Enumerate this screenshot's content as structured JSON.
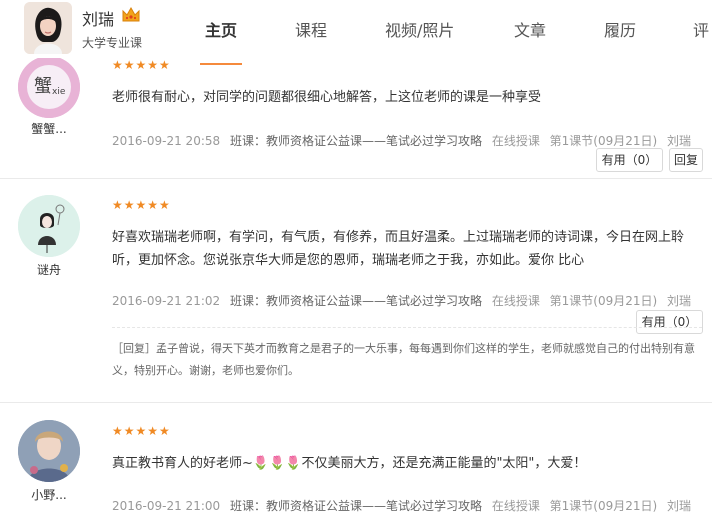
{
  "header": {
    "teacher_name": "刘瑞",
    "teacher_subtitle": "大学专业课",
    "nav": [
      {
        "label": "主页",
        "active": true
      },
      {
        "label": "课程",
        "active": false
      },
      {
        "label": "视频/照片",
        "active": false
      },
      {
        "label": "文章",
        "active": false
      },
      {
        "label": "履历",
        "active": false
      },
      {
        "label": "评",
        "active": false
      }
    ]
  },
  "reviews": [
    {
      "user": "蟹蟹...",
      "avatar_icon": "xie-doodle-avatar",
      "rating": 5,
      "stars": "★★★★★",
      "content": "老师很有耐心，对同学的问题都很细心地解答，上这位老师的课是一种享受",
      "date": "2016-09-21 20:58",
      "class": "班课：教师资格证公益课——笔试必过学习攻略",
      "mode": "在线授课",
      "lesson": "第1课节(09月21日)",
      "teacher": "刘瑞",
      "useful_label": "有用（0）",
      "reply_label": "回复"
    },
    {
      "user": "谜舟",
      "avatar_icon": "girl-doodle-avatar",
      "rating": 5,
      "stars": "★★★★★",
      "content": "好喜欢瑞瑞老师啊，有学问，有气质，有修养，而且好温柔。上过瑞瑞老师的诗词课，今日在网上聆听，更加怀念。您说张京华大师是您的恩师，瑞瑞老师之于我，亦如此。爱你  比心",
      "date": "2016-09-21 21:02",
      "class": "班课：教师资格证公益课——笔试必过学习攻略",
      "mode": "在线授课",
      "lesson": "第1课节(09月21日)",
      "teacher": "刘瑞",
      "useful_label": "有用（0）",
      "teacher_reply": "［回复］孟子曾说，得天下英才而教育之是君子的一大乐事，每每遇到你们这样的学生，老师就感觉自己的付出特别有意义，特别开心。谢谢，老师也爱你们。"
    },
    {
      "user": "小野...",
      "avatar_icon": "photo-avatar",
      "rating": 5,
      "stars": "★★★★★",
      "content": "真正教书育人的好老师~🌷🌷🌷不仅美丽大方，还是充满正能量的\"太阳\"，大爱！",
      "date": "2016-09-21 21:00",
      "class": "班课：教师资格证公益课——笔试必过学习攻略",
      "mode": "在线授课",
      "lesson": "第1课节(09月21日)",
      "teacher": "刘瑞"
    }
  ],
  "colors": {
    "accent": "#f58a3c",
    "star": "#f08a24",
    "meta_text": "#999999"
  }
}
